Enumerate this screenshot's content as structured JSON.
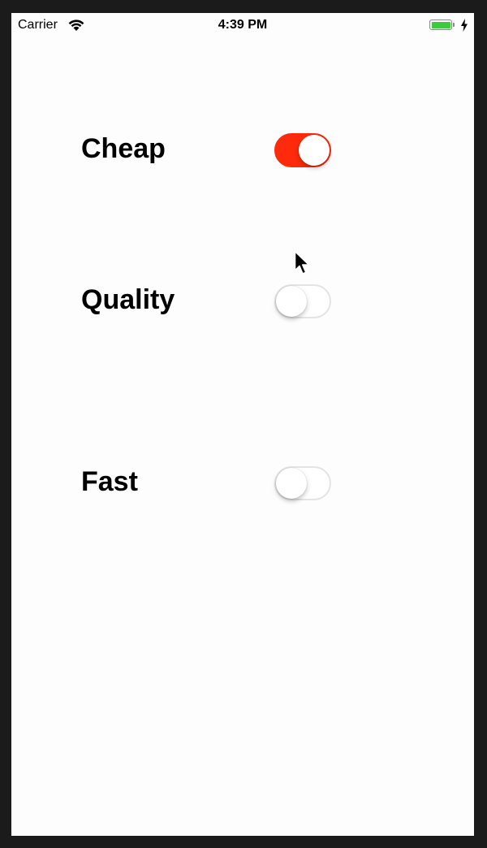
{
  "status_bar": {
    "carrier": "Carrier",
    "time": "4:39 PM",
    "battery_color": "#3ccb3c"
  },
  "settings": [
    {
      "label": "Cheap",
      "on": true
    },
    {
      "label": "Quality",
      "on": false
    },
    {
      "label": "Fast",
      "on": false
    }
  ],
  "colors": {
    "toggle_on": "#fd2a0c",
    "toggle_off_border": "#e4e4e6",
    "background": "#fefdfe"
  },
  "icons": {
    "wifi": "wifi-icon",
    "battery": "battery-icon",
    "charging": "charging-bolt-icon",
    "cursor": "mouse-pointer-icon"
  }
}
